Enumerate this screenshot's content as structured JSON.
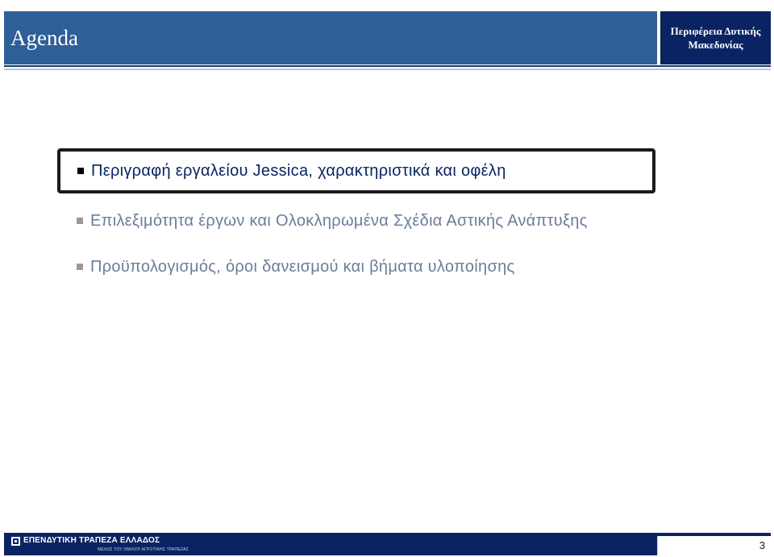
{
  "header": {
    "title": "Agenda",
    "brand_line1": "Περιφέρεια Δυτικής",
    "brand_line2": "Μακεδονίας"
  },
  "agenda": {
    "items": [
      {
        "label": "Περιγραφή εργαλείου Jessica, χαρακτηριστικά και οφέλη",
        "active": true
      },
      {
        "label": "Επιλεξιμότητα έργων και Ολοκληρωμένα Σχέδια Αστικής Ανάπτυξης",
        "active": false
      },
      {
        "label": "Προϋπολογισμός, όροι δανεισμού και βήματα υλοποίησης",
        "active": false
      }
    ]
  },
  "footer": {
    "bank_name": "ΕΠΕΝΔΥΤΙΚΗ ΤΡΑΠΕΖΑ ΕΛΛΑΔΟΣ",
    "bank_subtitle": "ΜΕΛΟΣ ΤΟΥ ΟΜΙΛΟΥ ΑΓΡΟΤΙΚΗΣ ΤΡΑΠΕΖΑΣ",
    "page_number": "3",
    "logo_icon": "bank-logo-icon"
  },
  "colors": {
    "header_blue": "#2f5f97",
    "brand_navy": "#0a2463",
    "active_text": "#0a2463",
    "muted_text": "#6b7d99"
  }
}
